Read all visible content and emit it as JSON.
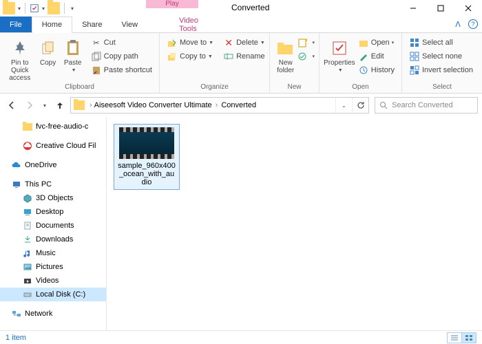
{
  "window": {
    "title": "Converted",
    "context_tab_header": "Play",
    "context_tab": "Video Tools"
  },
  "tabs": {
    "file": "File",
    "home": "Home",
    "share": "Share",
    "view": "View"
  },
  "ribbon": {
    "pin": "Pin to Quick\naccess",
    "copy": "Copy",
    "paste": "Paste",
    "cut": "Cut",
    "copypath": "Copy path",
    "pasteshort": "Paste shortcut",
    "clipboard_label": "Clipboard",
    "moveto": "Move to",
    "copyto": "Copy to",
    "delete": "Delete",
    "rename": "Rename",
    "organize_label": "Organize",
    "newfolder": "New\nfolder",
    "new_label": "New",
    "properties": "Properties",
    "open": "Open",
    "edit": "Edit",
    "history": "History",
    "open_label": "Open",
    "selectall": "Select all",
    "selectnone": "Select none",
    "invert": "Invert selection",
    "select_label": "Select"
  },
  "address": {
    "seg1": "Aiseesoft Video Converter Ultimate",
    "seg2": "Converted",
    "search_placeholder": "Search Converted"
  },
  "sidebar": {
    "fvc": "fvc-free-audio-c",
    "ccf": "Creative Cloud Fil",
    "onedrive": "OneDrive",
    "thispc": "This PC",
    "obj3d": "3D Objects",
    "desktop": "Desktop",
    "documents": "Documents",
    "downloads": "Downloads",
    "music": "Music",
    "pictures": "Pictures",
    "videos": "Videos",
    "localc": "Local Disk (C:)",
    "network": "Network"
  },
  "file": {
    "name": "sample_960x400_ocean_with_audio"
  },
  "status": {
    "count": "1 item"
  }
}
